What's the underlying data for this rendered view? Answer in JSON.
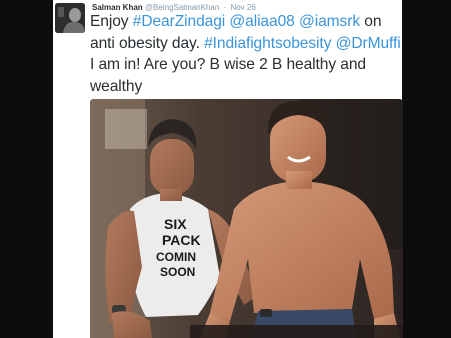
{
  "tweet": {
    "author_name": "Salman Khan",
    "author_handle": "@BeingSalmanKhan",
    "separator": "·",
    "timestamp": "Nov 26",
    "text": {
      "t1": "Enjoy ",
      "dearzindagi": "#DearZindagi",
      "t2": " ",
      "aliaa08": "@aliaa08",
      "t3": " ",
      "iamsrk": "@iamsrk",
      "t4": " on anti obesity day. ",
      "indiafightsobesity": "#Indiafightsobesity",
      "t5": " ",
      "drmuffi": "@DrMuffi",
      "t6": " I am in! Are you? B wise 2 B healthy and wealthy"
    },
    "photo": {
      "shirt_print": [
        "SIX",
        "PACK",
        "COMIN",
        "SOON"
      ]
    }
  },
  "colors": {
    "link": "#3b94d9",
    "text": "#292f33",
    "muted": "#8899a6",
    "frame": "#0d0d0d"
  }
}
